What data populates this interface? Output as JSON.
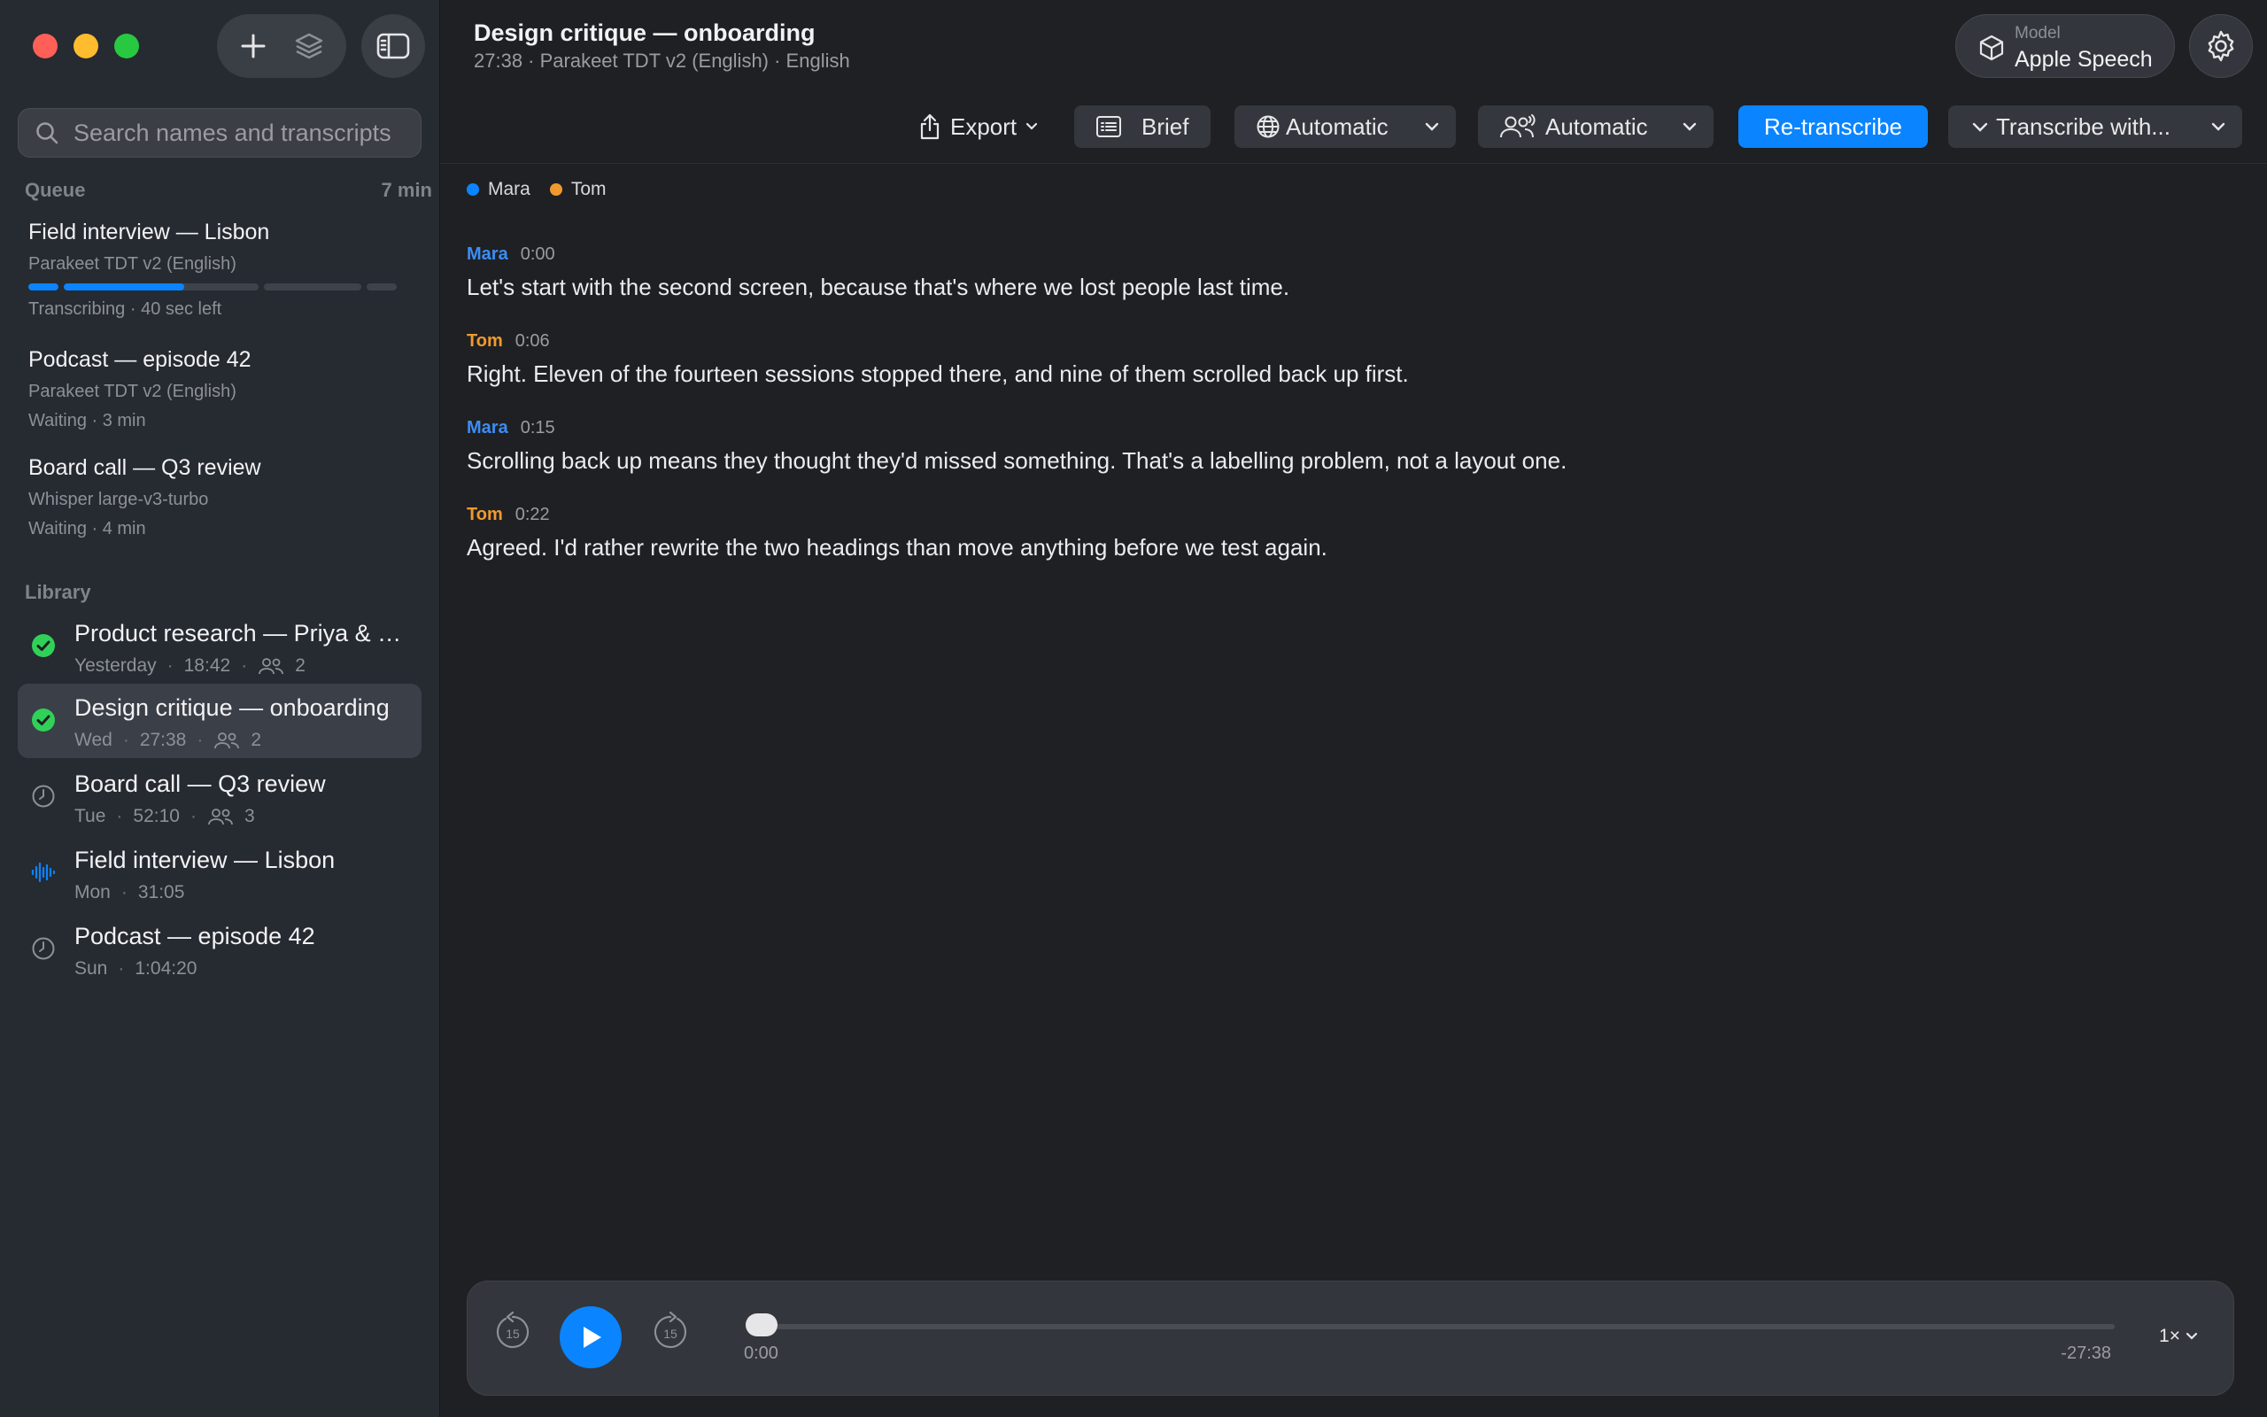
{
  "sidebar": {
    "search_placeholder": "Search names and transcripts",
    "queue": {
      "heading": "Queue",
      "total": "7 min",
      "items": [
        {
          "title": "Field interview — Lisbon",
          "model": "Parakeet TDT v2 (English)",
          "status": "Transcribing · 40 sec left",
          "progress": 0.62
        },
        {
          "title": "Podcast — episode 42",
          "model": "Parakeet TDT v2 (English)",
          "status": "Waiting · 3 min"
        },
        {
          "title": "Board call — Q3 review",
          "model": "Whisper large-v3-turbo",
          "status": "Waiting · 4 min"
        }
      ]
    },
    "library": {
      "heading": "Library",
      "items": [
        {
          "title": "Product research — Priya & S...",
          "day": "Yesterday",
          "time": "18:42",
          "speakers": "2",
          "state": "done"
        },
        {
          "title": "Design critique — onboarding",
          "day": "Wed",
          "time": "27:38",
          "speakers": "2",
          "state": "done",
          "selected": true
        },
        {
          "title": "Board call — Q3 review",
          "day": "Tue",
          "time": "52:10",
          "speakers": "3",
          "state": "queued"
        },
        {
          "title": "Field interview — Lisbon",
          "day": "Mon",
          "time": "31:05",
          "state": "transcribing"
        },
        {
          "title": "Podcast — episode 42",
          "day": "Sun",
          "time": "1:04:20",
          "state": "queued"
        }
      ]
    }
  },
  "header": {
    "title": "Design critique — onboarding",
    "subtitle": "27:38 · Parakeet TDT v2 (English) · English",
    "model_label": "Model",
    "model_value": "Apple Speech"
  },
  "toolbar": {
    "export": "Export",
    "brief": "Brief",
    "language": "Automatic",
    "speakers": "Automatic",
    "retranscribe": "Re-transcribe",
    "transcribe_with": "Transcribe with..."
  },
  "legend": [
    {
      "name": "Mara",
      "color": "#0a84ff"
    },
    {
      "name": "Tom",
      "color": "#f09a2e"
    }
  ],
  "transcript": [
    {
      "speaker": "Mara",
      "time": "0:00",
      "text": "Let's start with the second screen, because that's where we lost people last time."
    },
    {
      "speaker": "Tom",
      "time": "0:06",
      "text": "Right. Eleven of the fourteen sessions stopped there, and nine of them scrolled back up first."
    },
    {
      "speaker": "Mara",
      "time": "0:15",
      "text": "Scrolling back up means they thought they'd missed something. That's a labelling problem, not a layout one."
    },
    {
      "speaker": "Tom",
      "time": "0:22",
      "text": "Agreed. I'd rather rewrite the two headings than move anything before we test again."
    }
  ],
  "player": {
    "skip_back": "15",
    "skip_forward": "15",
    "elapsed": "0:00",
    "remaining": "-27:38",
    "speed": "1×",
    "position": 0
  }
}
